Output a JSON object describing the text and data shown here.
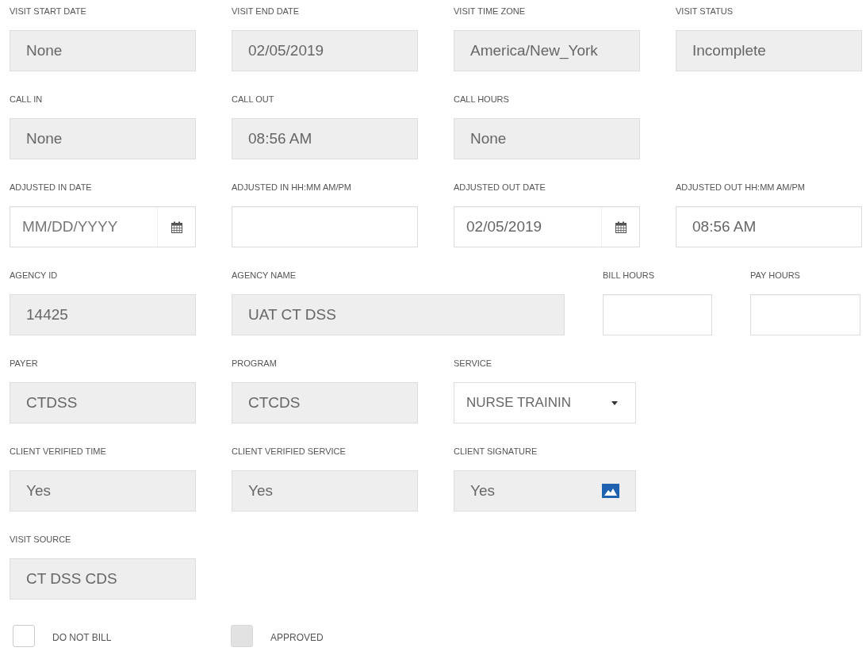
{
  "rows": [
    {
      "fields": [
        {
          "label": "VISIT START DATE",
          "kind": "readonly",
          "value": "None"
        },
        {
          "label": "VISIT END DATE",
          "kind": "readonly",
          "value": "02/05/2019"
        },
        {
          "label": "VISIT TIME ZONE",
          "kind": "readonly",
          "value": "America/New_York"
        },
        {
          "label": "VISIT STATUS",
          "kind": "readonly",
          "value": "Incomplete"
        }
      ]
    },
    {
      "fields": [
        {
          "label": "CALL IN",
          "kind": "readonly",
          "value": "None"
        },
        {
          "label": "CALL OUT",
          "kind": "readonly",
          "value": "08:56 AM"
        },
        {
          "label": "CALL HOURS",
          "kind": "readonly",
          "value": "None"
        }
      ]
    },
    {
      "fields": [
        {
          "label": "ADJUSTED IN DATE",
          "kind": "date",
          "placeholder": "MM/DD/YYYY"
        },
        {
          "label": "ADJUSTED IN HH:MM AM/PM",
          "kind": "text"
        },
        {
          "label": "ADJUSTED OUT DATE",
          "kind": "date",
          "value": "02/05/2019"
        },
        {
          "label": "ADJUSTED OUT HH:MM AM/PM",
          "kind": "text",
          "value": "08:56 AM"
        }
      ]
    },
    {
      "fields": [
        {
          "label": "AGENCY ID",
          "kind": "readonly",
          "value": "14425"
        },
        {
          "label": "AGENCY NAME",
          "kind": "readonly",
          "value": "UAT CT DSS"
        },
        {
          "label": "BILL HOURS",
          "kind": "text"
        },
        {
          "label": "PAY HOURS",
          "kind": "text"
        }
      ]
    },
    {
      "fields": [
        {
          "label": "PAYER",
          "kind": "readonly",
          "value": "CTDSS"
        },
        {
          "label": "PROGRAM",
          "kind": "readonly",
          "value": "CTCDS"
        },
        {
          "label": "SERVICE",
          "kind": "select",
          "value": "NURSE TRAININ"
        }
      ]
    },
    {
      "fields": [
        {
          "label": "CLIENT VERIFIED TIME",
          "kind": "readonly",
          "value": "Yes"
        },
        {
          "label": "CLIENT VERIFIED SERVICE",
          "kind": "readonly",
          "value": "Yes"
        },
        {
          "label": "CLIENT SIGNATURE",
          "kind": "signature",
          "value": "Yes"
        }
      ]
    },
    {
      "fields": [
        {
          "label": "VISIT SOURCE",
          "kind": "readonly",
          "value": "CT DSS CDS"
        }
      ]
    }
  ],
  "checkboxes": [
    {
      "label": "DO NOT BILL",
      "checked": false,
      "disabled": false
    },
    {
      "label": "APPROVED",
      "checked": false,
      "disabled": true
    }
  ]
}
